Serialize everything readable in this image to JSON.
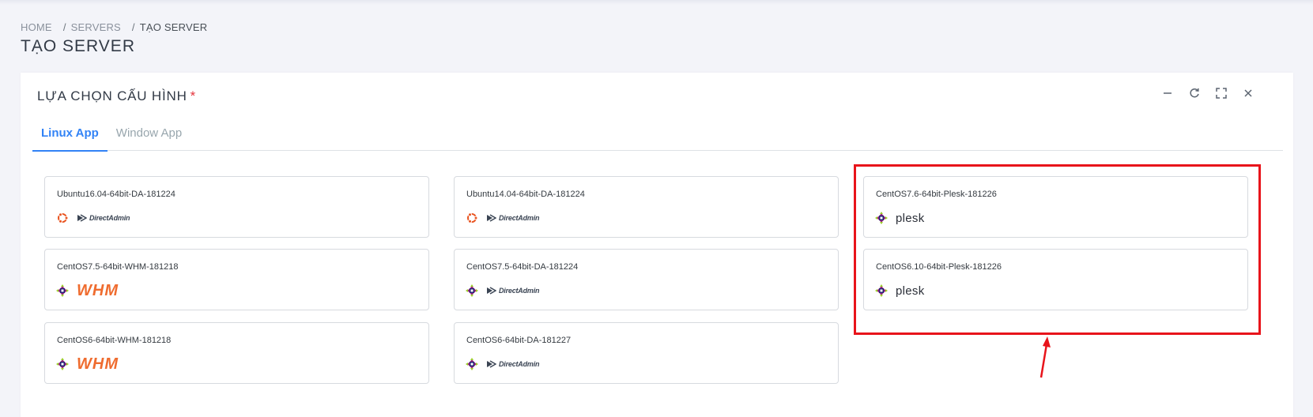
{
  "breadcrumb": {
    "home": "HOME",
    "servers": "SERVERS",
    "current": "TẠO SERVER",
    "separator": "/"
  },
  "page": {
    "title": "TẠO SERVER"
  },
  "card": {
    "title": "LỰA CHỌN CẤU HÌNH",
    "required_mark": "*",
    "tools": [
      "minimize-icon",
      "refresh-icon",
      "fullscreen-icon",
      "close-icon"
    ]
  },
  "tabs": [
    {
      "label": "Linux App",
      "active": true
    },
    {
      "label": "Window App",
      "active": false
    }
  ],
  "os_options": [
    {
      "name": "Ubuntu16.04-64bit-DA-181224",
      "os_icon": "ubuntu-icon",
      "panel": "DirectAdmin"
    },
    {
      "name": "Ubuntu14.04-64bit-DA-181224",
      "os_icon": "ubuntu-icon",
      "panel": "DirectAdmin"
    },
    {
      "name": "CentOS7.6-64bit-Plesk-181226",
      "os_icon": "centos-icon",
      "panel": "plesk"
    },
    {
      "name": "CentOS7.5-64bit-WHM-181218",
      "os_icon": "centos-icon",
      "panel": "WHM"
    },
    {
      "name": "CentOS7.5-64bit-DA-181224",
      "os_icon": "centos-icon",
      "panel": "DirectAdmin"
    },
    {
      "name": "CentOS6.10-64bit-Plesk-181226",
      "os_icon": "centos-icon",
      "panel": "plesk"
    },
    {
      "name": "CentOS6-64bit-WHM-181218",
      "os_icon": "centos-icon",
      "panel": "WHM"
    },
    {
      "name": "CentOS6-64bit-DA-181227",
      "os_icon": "centos-icon",
      "panel": "DirectAdmin"
    }
  ],
  "colors": {
    "accent": "#3283f6",
    "required": "#e5353d",
    "highlight": "#e8141b",
    "ubuntu": "#e95420",
    "centos": "#932279",
    "whm": "#ef6c2f"
  }
}
